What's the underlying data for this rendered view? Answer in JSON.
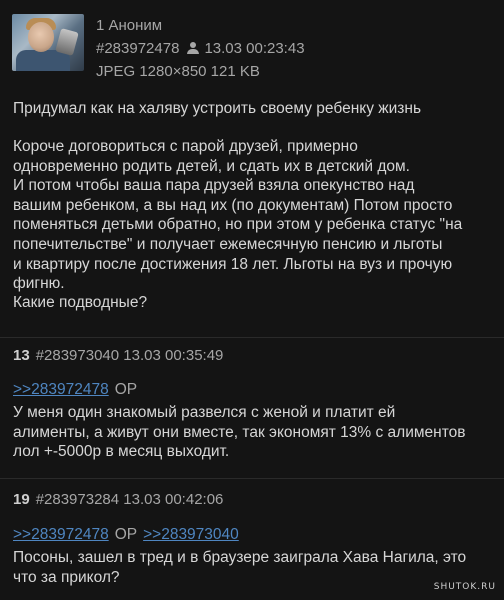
{
  "op": {
    "post_number": "1",
    "author": "Аноним",
    "post_id": "#283972478",
    "datetime": "13.03 00:23:43",
    "file_info": "JPEG 1280×850 121 KB",
    "thumbnail_icon": "photo-thumbnail",
    "title": "Придумал как на халяву устроить своему ребенку жизнь",
    "body_lines": [
      "Короче договориться с парой друзей, примерно",
      "одновременно родить детей, и сдать их в детский дом.",
      "И потом чтобы ваша пара друзей взяла опекунство над",
      "вашим ребенком, а вы над их (по документам) Потом просто",
      "поменяться детьми обратно, но при этом у ребенка статус \"на",
      "попечительстве\" и получает ежемесячную пенсию и льготы",
      "и квартиру после достижения 18 лет. Льготы на вуз и прочую",
      "фигню."
    ],
    "question": "Какие подводные?"
  },
  "replies": [
    {
      "number": "13",
      "post_id": "#283973040",
      "datetime": "13.03 00:35:49",
      "refs": [
        {
          "link": ">>283972478",
          "tag": "OP"
        }
      ],
      "body_lines": [
        "У меня один знакомый развелся с женой и платит ей",
        "алименты, а живут они вместе, так экономят 13% с алиментов",
        "лол +-5000р в месяц выходит."
      ]
    },
    {
      "number": "19",
      "post_id": "#283973284",
      "datetime": "13.03 00:42:06",
      "refs": [
        {
          "link": ">>283972478",
          "tag": "OP"
        },
        {
          "link": ">>283973040",
          "tag": ""
        }
      ],
      "body_lines": [
        "Посоны, зашел в тред и в браузере заиграла Хава Нагила, это",
        "что за прикол?"
      ]
    }
  ],
  "watermark": "SHUTOK.RU",
  "colors": {
    "background": "#141414",
    "link": "#4f86c1",
    "meta": "#a6a6a6",
    "text": "#d6d6d6"
  }
}
